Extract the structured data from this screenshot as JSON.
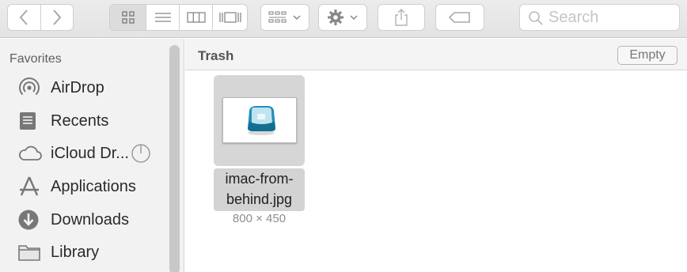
{
  "toolbar": {
    "back_icon": "chevron-left-icon",
    "forward_icon": "chevron-right-icon",
    "view_modes": [
      "icon-view",
      "list-view",
      "column-view",
      "gallery-view"
    ],
    "active_view": "icon-view",
    "search_placeholder": "Search"
  },
  "sidebar": {
    "header": "Favorites",
    "items": [
      {
        "label": "AirDrop",
        "icon": "airdrop-icon"
      },
      {
        "label": "Recents",
        "icon": "recents-icon"
      },
      {
        "label": "iCloud Dr...",
        "icon": "icloud-icon"
      },
      {
        "label": "Applications",
        "icon": "applications-icon"
      },
      {
        "label": "Downloads",
        "icon": "downloads-icon"
      },
      {
        "label": "Library",
        "icon": "folder-icon"
      }
    ]
  },
  "main": {
    "folder_title": "Trash",
    "empty_label": "Empty",
    "files": [
      {
        "name_line1": "imac-from-",
        "name_line2": "behind.jpg",
        "dimensions": "800 × 450"
      }
    ]
  },
  "colors": {
    "selection_bg": "#d6d6d6",
    "toolbar_bg": "#e6e6e6",
    "sidebar_bg": "#f2f2f2",
    "imac_accent": "#1f8fb8"
  }
}
